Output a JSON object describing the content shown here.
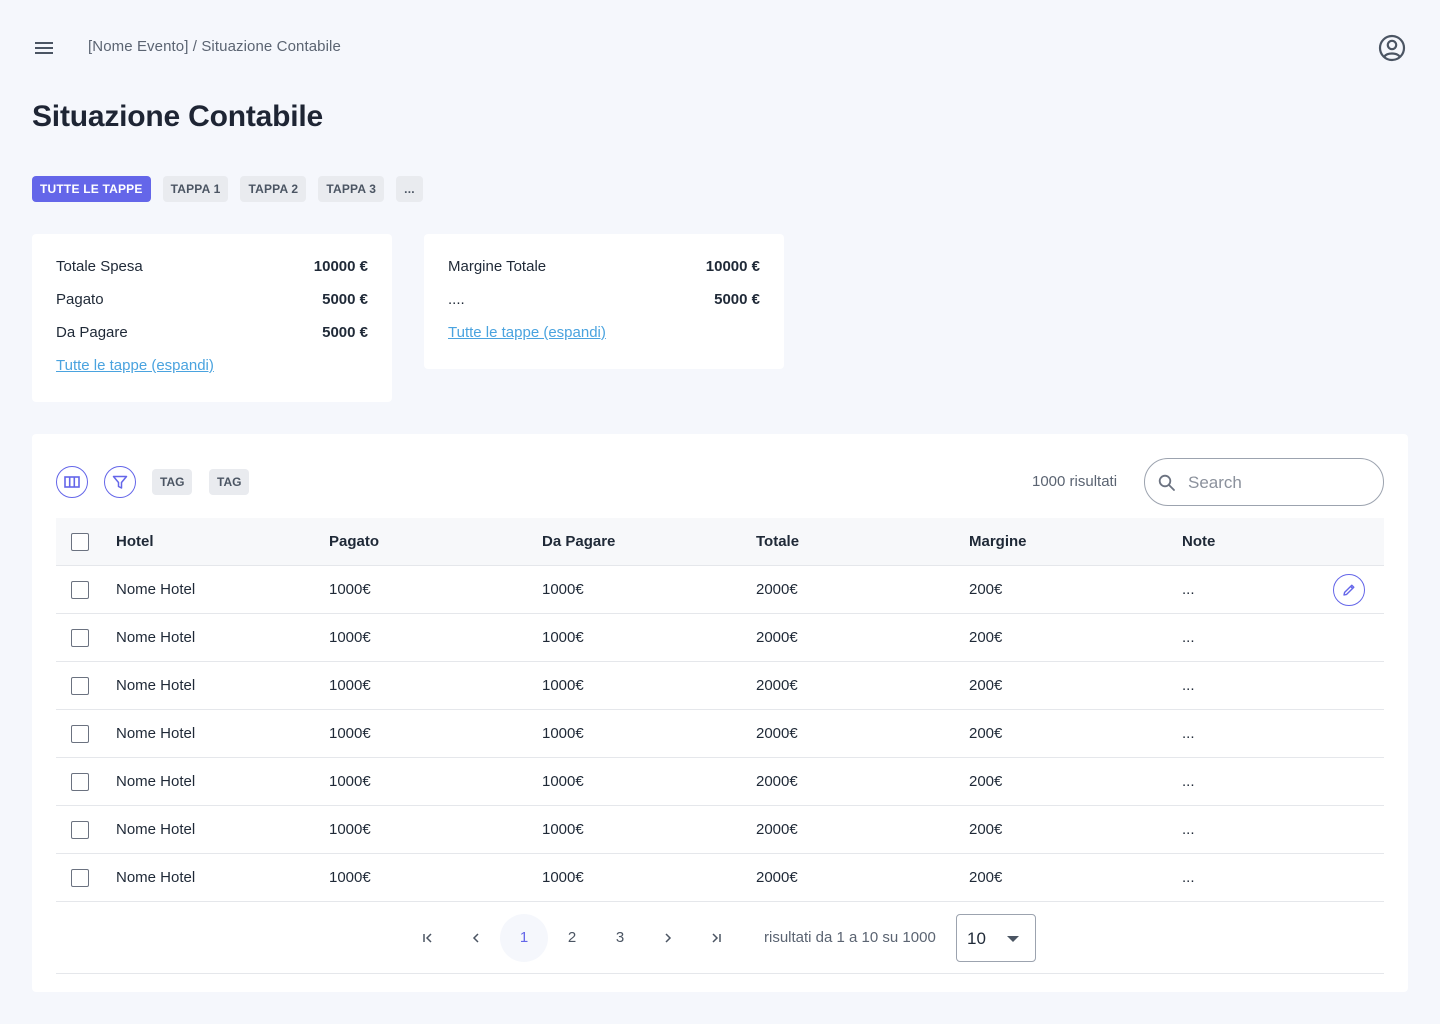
{
  "header": {
    "breadcrumb": "[Nome Evento] / Situazione Contabile"
  },
  "page": {
    "title": "Situazione Contabile"
  },
  "stage_tabs": [
    "TUTTE LE TAPPE",
    "TAPPA 1",
    "TAPPA 2",
    "TAPPA 3",
    "..."
  ],
  "stage_tabs_active": 0,
  "summary_left": {
    "rows": [
      {
        "label": "Totale Spesa",
        "value": "10000 €"
      },
      {
        "label": "Pagato",
        "value": "5000 €"
      },
      {
        "label": "Da Pagare",
        "value": "5000 €"
      }
    ],
    "link": "Tutte le tappe (espandi)"
  },
  "summary_right": {
    "rows": [
      {
        "label": "Margine Totale",
        "value": "10000 €"
      },
      {
        "label": "....",
        "value": "5000 €"
      }
    ],
    "link": "Tutte le tappe (espandi)"
  },
  "toolbar": {
    "tags": [
      "TAG",
      "TAG"
    ],
    "results_count": "1000 risultati",
    "search_placeholder": "Search"
  },
  "table": {
    "columns": [
      "Hotel",
      "Pagato",
      "Da Pagare",
      "Totale",
      "Margine",
      "Note"
    ],
    "rows": [
      {
        "hotel": "Nome Hotel",
        "pagato": "1000€",
        "da_pagare": "1000€",
        "totale": "2000€",
        "margine": "200€",
        "note": "..."
      },
      {
        "hotel": "Nome Hotel",
        "pagato": "1000€",
        "da_pagare": "1000€",
        "totale": "2000€",
        "margine": "200€",
        "note": "..."
      },
      {
        "hotel": "Nome Hotel",
        "pagato": "1000€",
        "da_pagare": "1000€",
        "totale": "2000€",
        "margine": "200€",
        "note": "..."
      },
      {
        "hotel": "Nome Hotel",
        "pagato": "1000€",
        "da_pagare": "1000€",
        "totale": "2000€",
        "margine": "200€",
        "note": "..."
      },
      {
        "hotel": "Nome Hotel",
        "pagato": "1000€",
        "da_pagare": "1000€",
        "totale": "2000€",
        "margine": "200€",
        "note": "..."
      },
      {
        "hotel": "Nome Hotel",
        "pagato": "1000€",
        "da_pagare": "1000€",
        "totale": "2000€",
        "margine": "200€",
        "note": "..."
      },
      {
        "hotel": "Nome Hotel",
        "pagato": "1000€",
        "da_pagare": "1000€",
        "totale": "2000€",
        "margine": "200€",
        "note": "..."
      }
    ]
  },
  "pagination": {
    "pages": [
      "1",
      "2",
      "3"
    ],
    "current_page": "1",
    "info": "risultati da 1 a 10 su 1000",
    "page_size": "10"
  },
  "colors": {
    "accent": "#6466e9",
    "link": "#4aa3df",
    "background": "#f5f7fc"
  },
  "icons": {
    "menu": "hamburger-menu-icon",
    "account": "account-circle-icon",
    "columns": "columns-icon",
    "filter": "filter-icon",
    "search": "search-icon",
    "edit": "pencil-icon"
  }
}
